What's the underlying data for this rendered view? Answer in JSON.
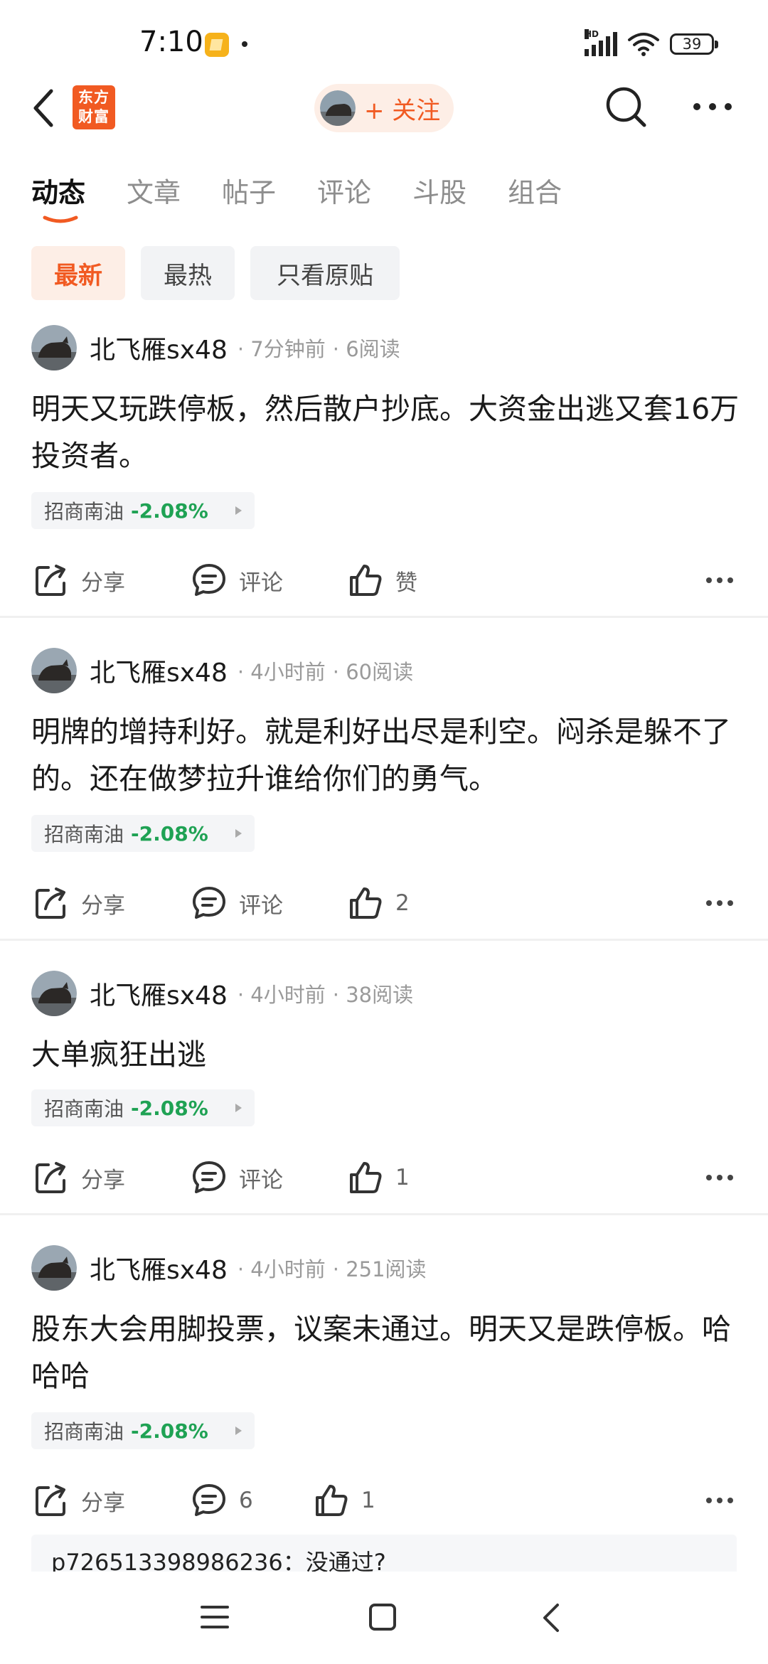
{
  "status_bar": {
    "time": "7:10",
    "battery": "39",
    "network": "HD"
  },
  "header": {
    "logo_line1": "东方",
    "logo_line2": "财富",
    "follow_label": "+ 关注",
    "back_icon": "back-chevron-icon",
    "search_icon": "search-icon",
    "more_icon": "more-dots-icon"
  },
  "tabs": [
    {
      "label": "动态",
      "active": true
    },
    {
      "label": "文章"
    },
    {
      "label": "帖子"
    },
    {
      "label": "评论"
    },
    {
      "label": "斗股"
    },
    {
      "label": "组合"
    }
  ],
  "filters": [
    {
      "label": "最新",
      "active": true
    },
    {
      "label": "最热"
    },
    {
      "label": "只看原贴"
    }
  ],
  "colors": {
    "accent": "#f15a22",
    "stock_down": "#1fa254"
  },
  "posts": [
    {
      "author": "北飞雁sx48",
      "time": "· 7分钟前",
      "reads": "· 6阅读",
      "text": "明天又玩跌停板，然后散户抄底。大资金出逃又套16万投资者。",
      "stock_name": "招商南油",
      "stock_change": "-2.08%",
      "share": "分享",
      "comment": "评论",
      "like": "赞"
    },
    {
      "author": "北飞雁sx48",
      "time": "· 4小时前",
      "reads": "· 60阅读",
      "text": "明牌的增持利好。就是利好出尽是利空。闷杀是躲不了的。还在做梦拉升谁给你们的勇气。",
      "stock_name": "招商南油",
      "stock_change": "-2.08%",
      "share": "分享",
      "comment": "评论",
      "like": "2"
    },
    {
      "author": "北飞雁sx48",
      "time": "· 4小时前",
      "reads": "· 38阅读",
      "text": "大单疯狂出逃",
      "stock_name": "招商南油",
      "stock_change": "-2.08%",
      "share": "分享",
      "comment": "评论",
      "like": "1"
    },
    {
      "author": "北飞雁sx48",
      "time": "· 4小时前",
      "reads": "· 251阅读",
      "text": "股东大会用脚投票，议案未通过。明天又是跌停板。哈哈哈",
      "stock_name": "招商南油",
      "stock_change": "-2.08%",
      "share": "分享",
      "comment": "6",
      "like": "1"
    }
  ],
  "comment_preview": "p726513398986236：没通过?"
}
